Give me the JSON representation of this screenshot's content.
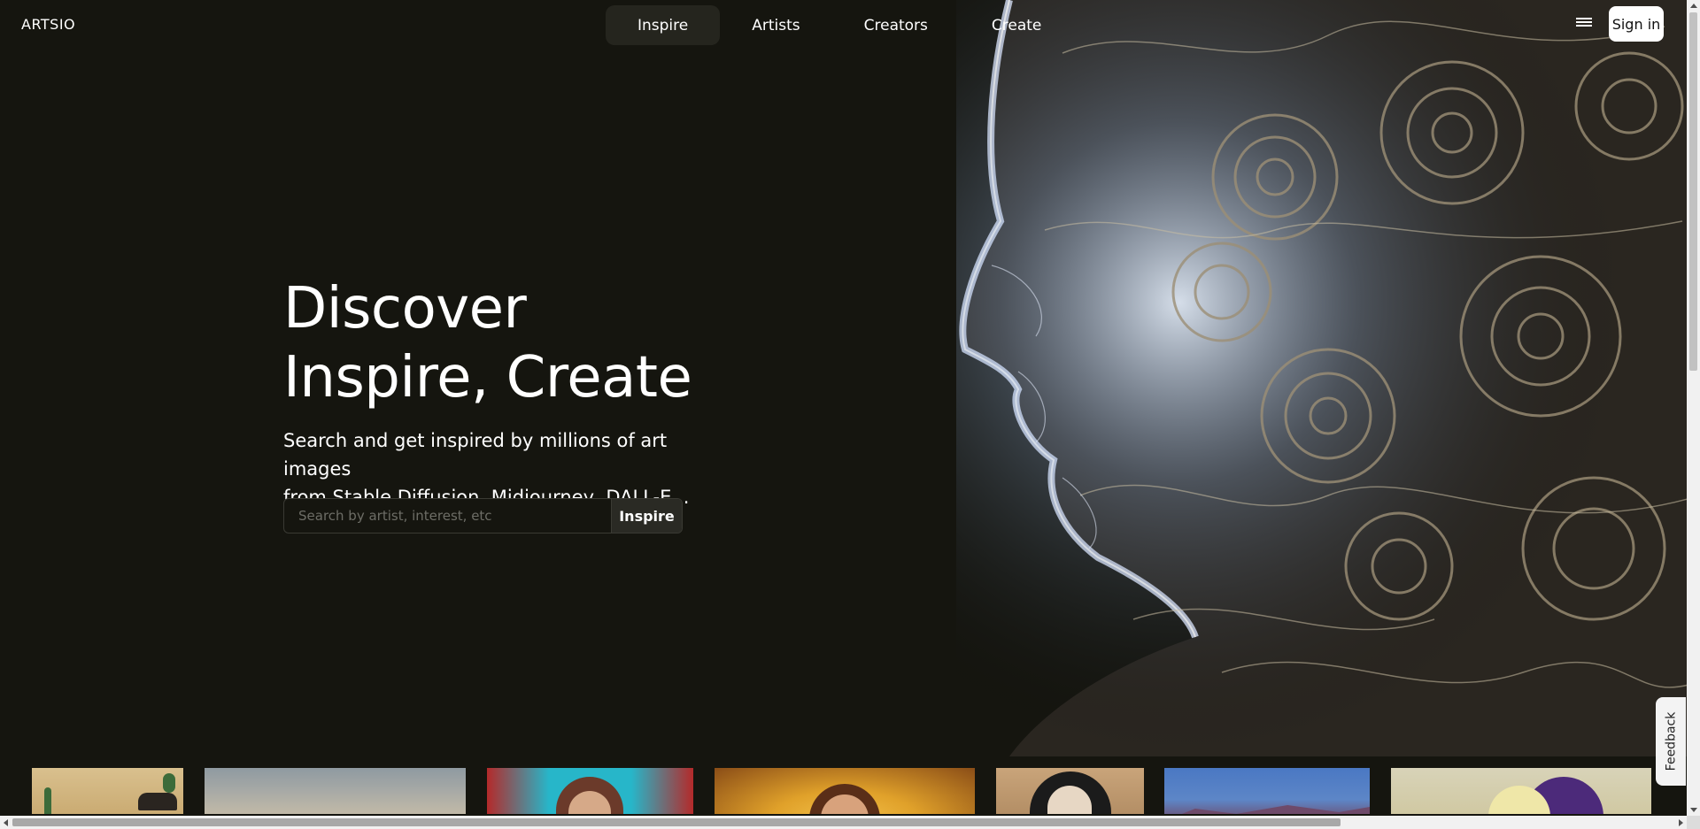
{
  "brand": {
    "logo": "ARTSIO"
  },
  "nav": {
    "items": [
      {
        "label": "Inspire",
        "active": true
      },
      {
        "label": "Artists",
        "active": false
      },
      {
        "label": "Creators",
        "active": false
      },
      {
        "label": "Create",
        "active": false
      }
    ],
    "menu_icon": "hamburger-menu-icon",
    "signin_label": "Sign in"
  },
  "hero": {
    "title_line1": "Discover",
    "title_line2": "Inspire, Create",
    "subtitle_line1": "Search and get inspired by millions of art images",
    "subtitle_line2": "from Stable Diffusion, Midjourney, DALL-E...",
    "search": {
      "placeholder": "Search by artist, interest, etc",
      "value": "",
      "button_label": "Inspire"
    }
  },
  "thumbnails": [
    {
      "name": "cactus-painting",
      "colors": [
        "#d9c08e",
        "#3c6b3a"
      ]
    },
    {
      "name": "desert-landscape",
      "colors": [
        "#8f9aa1",
        "#c9bfa8"
      ]
    },
    {
      "name": "graffiti-portrait",
      "colors": [
        "#27b6c9",
        "#b42a2a"
      ]
    },
    {
      "name": "golden-portrait",
      "colors": [
        "#e0a12a",
        "#6b3a1f"
      ]
    },
    {
      "name": "dark-hair-portrait",
      "colors": [
        "#c9a47a",
        "#1b1b1b"
      ]
    },
    {
      "name": "mountain-sky",
      "colors": [
        "#4a78c3",
        "#6e4a6a"
      ]
    },
    {
      "name": "iris-flower",
      "colors": [
        "#d8d3b8",
        "#4c2a7a"
      ]
    }
  ],
  "feedback_label": "Feedback",
  "colors": {
    "background": "#15150f",
    "nav_active": "#25251e",
    "signin_bg": "#ffffff"
  }
}
